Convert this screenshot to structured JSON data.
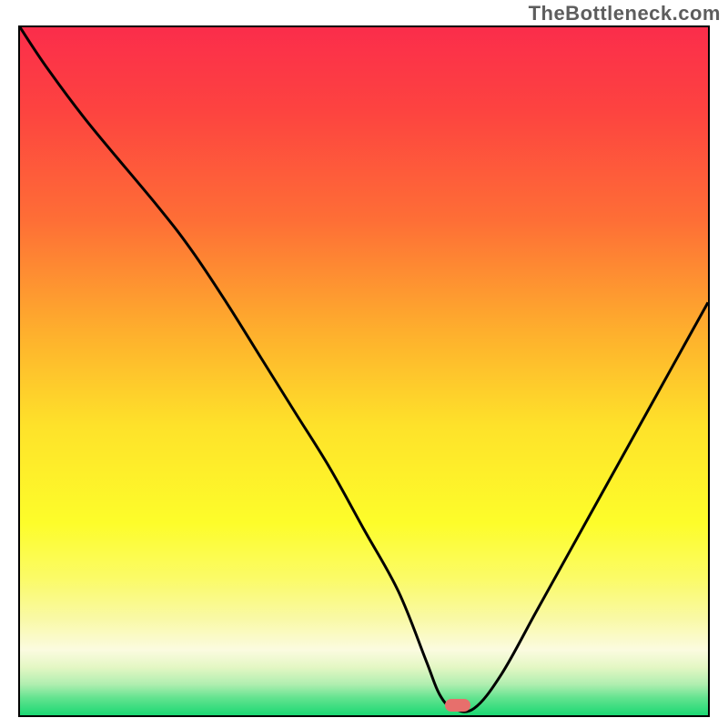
{
  "watermark": "TheBottleneck.com",
  "colors": {
    "frame": "#000000",
    "curve": "#000000",
    "marker": "#e76f6c",
    "gradient_stops": [
      {
        "offset": 0.0,
        "color": "#fb2d4b"
      },
      {
        "offset": 0.12,
        "color": "#fd4340"
      },
      {
        "offset": 0.28,
        "color": "#fe6e36"
      },
      {
        "offset": 0.44,
        "color": "#feae2d"
      },
      {
        "offset": 0.58,
        "color": "#fee22a"
      },
      {
        "offset": 0.72,
        "color": "#fdfd2a"
      },
      {
        "offset": 0.8,
        "color": "#fbfb66"
      },
      {
        "offset": 0.86,
        "color": "#f9f9a6"
      },
      {
        "offset": 0.905,
        "color": "#fbfbe0"
      },
      {
        "offset": 0.93,
        "color": "#e4f7c4"
      },
      {
        "offset": 0.955,
        "color": "#b0eeb0"
      },
      {
        "offset": 0.975,
        "color": "#62e38f"
      },
      {
        "offset": 1.0,
        "color": "#1bd873"
      }
    ]
  },
  "marker": {
    "x_frac": 0.636,
    "y_frac": 0.985
  },
  "chart_data": {
    "type": "line",
    "title": "",
    "xlabel": "",
    "ylabel": "",
    "xlim": [
      0,
      100
    ],
    "ylim": [
      0,
      100
    ],
    "x": [
      0,
      4,
      10,
      20,
      25,
      30,
      35,
      40,
      45,
      50,
      55,
      59,
      61,
      63,
      66,
      70,
      75,
      80,
      85,
      90,
      95,
      100
    ],
    "y": [
      100,
      94,
      86,
      74,
      67.5,
      60,
      52,
      44,
      36,
      27,
      18,
      8,
      3,
      1,
      1,
      6,
      15,
      24,
      33,
      42,
      51,
      60
    ],
    "annotations": [
      {
        "text": "TheBottleneck.com",
        "role": "watermark"
      }
    ],
    "highlight": {
      "x": 63.6,
      "y": 1.5,
      "shape": "pill",
      "color": "#e76f6c"
    }
  }
}
